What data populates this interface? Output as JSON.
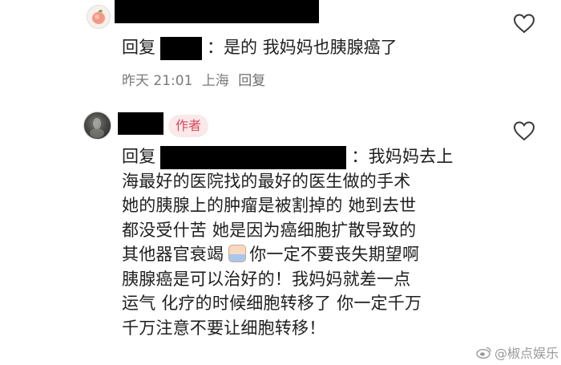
{
  "comment1": {
    "reply_prefix": "回复",
    "separator": "：",
    "text": "是的 我妈妈也胰腺癌了",
    "time": "昨天 21:01",
    "location": "上海",
    "reply_button": "回复"
  },
  "comment2": {
    "author_badge": "作者",
    "reply_prefix": "回复",
    "separator": "：",
    "line1_tail": "我妈妈去上",
    "lines": [
      "海最好的医院找的最好的医生做的手术",
      "她的胰腺上的肿瘤是被割掉的 她到去世",
      "都没受什苦 她是因为癌细胞扩散导致的"
    ],
    "line5_before_emoji": "其他器官衰竭",
    "line5_after_emoji": "你一定不要丧失期望啊",
    "lines_after": [
      "胰腺癌是可以治好的！我妈妈就差一点",
      "运气 化疗的时候细胞转移了 你一定千万",
      "千万注意不要让细胞转移！"
    ]
  },
  "watermark": "@椒点娱乐",
  "icons": {
    "avatar1": "peach-avatar",
    "avatar2": "dark-photo-avatar",
    "like": "heart-outline-icon",
    "emoji": "crying-emoji-icon",
    "watermark_logo": "weibo-logo-icon"
  }
}
